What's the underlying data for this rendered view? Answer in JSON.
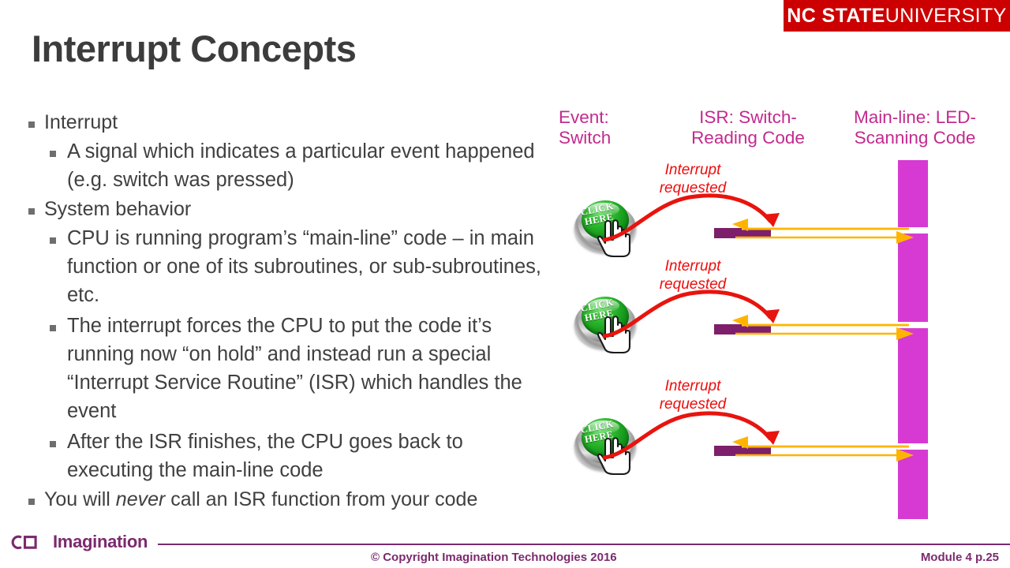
{
  "brand": {
    "university_bold": "NC STATE",
    "university_light": "UNIVERSITY",
    "university_banner_color": "#cc0000",
    "imagination_wordmark": "Imagination",
    "imagination_color": "#7b2a6e"
  },
  "title": "Interrupt Concepts",
  "body": {
    "bullets": [
      {
        "level": 1,
        "text": "Interrupt",
        "children": [
          {
            "level": 2,
            "text": "A signal which indicates a particular event happened (e.g. switch was pressed)"
          }
        ]
      },
      {
        "level": 1,
        "text": "System behavior",
        "children": [
          {
            "level": 2,
            "text": "CPU is running program’s “main-line” code – in main function or one of its subroutines, or sub-subroutines, etc."
          },
          {
            "level": 2,
            "text": "The interrupt forces the CPU to put the code it’s running now “on hold” and instead run a special “Interrupt Service Routine” (ISR) which handles the event"
          },
          {
            "level": 2,
            "text": "After the ISR finishes, the CPU goes back to executing the main-line code"
          }
        ]
      },
      {
        "level": 1,
        "text_pre": "You will ",
        "text_italic": "never",
        "text_post": " call an ISR function from your code",
        "children": []
      }
    ]
  },
  "diagram": {
    "headers": {
      "event": "Event:\nSwitch",
      "isr": "ISR: Switch-\nReading Code",
      "mainline": "Main-line: LED-\nScanning Code"
    },
    "header_color": "#c32a8e",
    "button_label": "CLICK\nHERE",
    "button_color": "#16a016",
    "interrupt_caption": "Interrupt\nrequested",
    "interrupt_caption_color": "#ee0d0d",
    "isr_bar_color": "#7d1f6b",
    "mainline_bar_color": "#d63ad2",
    "flow_arrow_color": "#ffb400",
    "events": [
      {
        "id": 1,
        "caption": "Interrupt\nrequested"
      },
      {
        "id": 2,
        "caption": "Interrupt\nrequested"
      },
      {
        "id": 3,
        "caption": "Interrupt\nrequested"
      }
    ]
  },
  "footer": {
    "copyright": "© Copyright Imagination Technologies 2016",
    "module": "Module 4 p.25"
  }
}
